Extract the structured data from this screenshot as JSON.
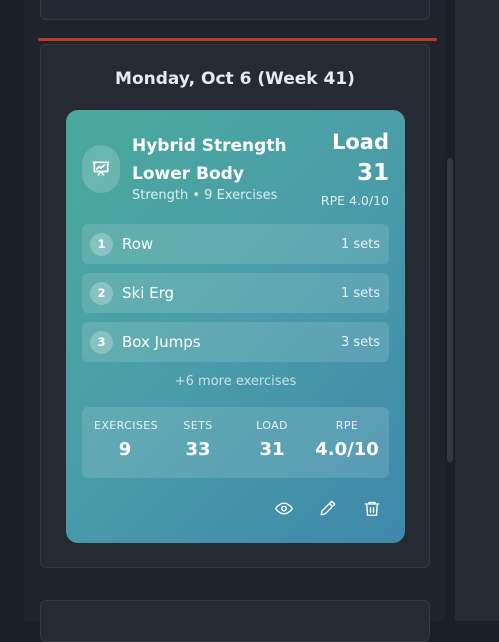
{
  "day": {
    "title": "Monday, Oct 6 (Week 41)"
  },
  "workout": {
    "title_line1": "Hybrid Strength",
    "title_line2": "Lower Body",
    "subtitle": "Strength • 9 Exercises",
    "load_label": "Load",
    "load_value": "31",
    "rpe": "RPE 4.0/10",
    "icon": "chart-presentation-icon",
    "gradient": [
      "#4aa99c",
      "#3f88ab"
    ],
    "exercises": [
      {
        "num": "1",
        "name": "Row",
        "sets": "1 sets"
      },
      {
        "num": "2",
        "name": "Ski Erg",
        "sets": "1 sets"
      },
      {
        "num": "3",
        "name": "Box Jumps",
        "sets": "3 sets"
      }
    ],
    "more_text": "+6 more exercises",
    "stats": [
      {
        "label": "EXERCISES",
        "value": "9"
      },
      {
        "label": "SETS",
        "value": "33"
      },
      {
        "label": "LOAD",
        "value": "31"
      },
      {
        "label": "RPE",
        "value": "4.0/10"
      }
    ],
    "actions": [
      "eye-icon",
      "pencil-icon",
      "trash-icon"
    ]
  },
  "colors": {
    "today_indicator": "#c0392b",
    "background": "#1f232c",
    "card": "#252a33"
  }
}
